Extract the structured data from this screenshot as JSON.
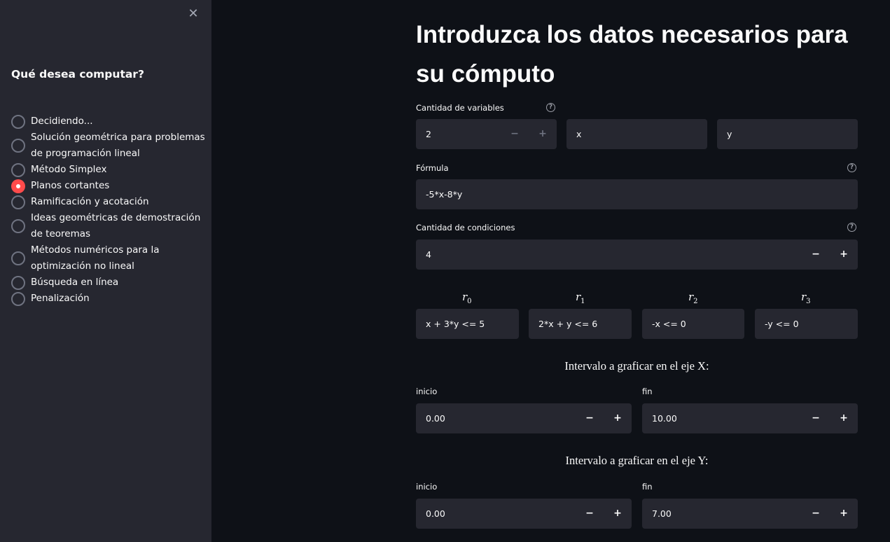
{
  "sidebar": {
    "close_icon": "close-icon",
    "heading": "Qué desea computar?",
    "options": [
      {
        "label": "Decidiendo...",
        "checked": false
      },
      {
        "label": "Solución geométrica para problemas de programación lineal",
        "checked": false
      },
      {
        "label": "Método Simplex",
        "checked": false
      },
      {
        "label": "Planos cortantes",
        "checked": true
      },
      {
        "label": "Ramificación y acotación",
        "checked": false
      },
      {
        "label": "Ideas geométricas de demostración de teoremas",
        "checked": false
      },
      {
        "label": "Métodos numéricos para la optimización no lineal",
        "checked": false
      },
      {
        "label": "Búsqueda en línea",
        "checked": false
      },
      {
        "label": "Penalización",
        "checked": false
      }
    ]
  },
  "main": {
    "title": "Introduzca los datos necesarios para su cómputo",
    "variables": {
      "label": "Cantidad de variables",
      "value": "2",
      "names": [
        "x",
        "y"
      ]
    },
    "formula": {
      "label": "Fórmula",
      "value": "-5*x-8*y"
    },
    "conditions": {
      "label": "Cantidad de condiciones",
      "value": "4",
      "items": [
        {
          "symbol": "r",
          "index": "0",
          "value": "x + 3*y <= 5"
        },
        {
          "symbol": "r",
          "index": "1",
          "value": "2*x + y <= 6"
        },
        {
          "symbol": "r",
          "index": "2",
          "value": "-x <= 0"
        },
        {
          "symbol": "r",
          "index": "3",
          "value": "-y <= 0"
        }
      ]
    },
    "x_interval": {
      "heading": "Intervalo a graficar en el eje X:",
      "start_label": "inicio",
      "start_value": "0.00",
      "end_label": "fin",
      "end_value": "10.00"
    },
    "y_interval": {
      "heading": "Intervalo a graficar en el eje Y:",
      "start_label": "inicio",
      "start_value": "0.00",
      "end_label": "fin",
      "end_value": "7.00"
    },
    "stepper": {
      "minus": "−",
      "plus": "+"
    },
    "help_glyph": "?"
  },
  "colors": {
    "background": "#0e1117",
    "sidebar": "#262730",
    "input": "#262730",
    "accent": "#ff4b4b"
  }
}
